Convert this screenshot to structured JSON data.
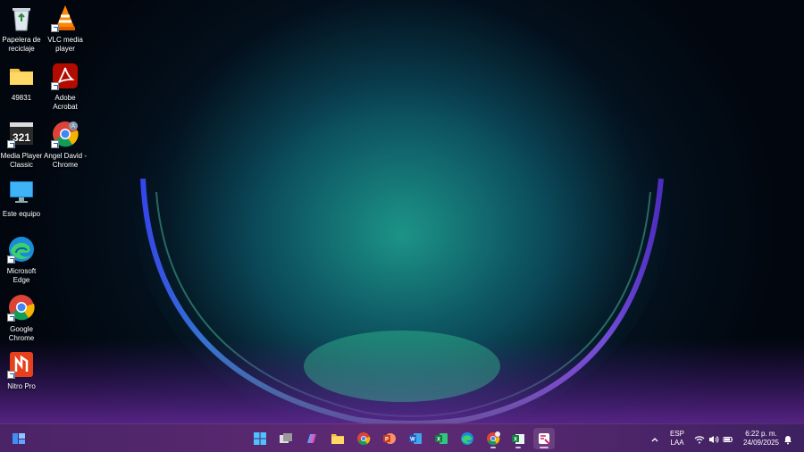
{
  "desktop": {
    "icons": [
      {
        "label": "Papelera de reciclaje",
        "icon": "recycle-bin-icon"
      },
      {
        "label": "VLC media player",
        "icon": "vlc-icon"
      },
      {
        "label": "49831",
        "icon": "folder-icon"
      },
      {
        "label": "Adobe Acrobat",
        "icon": "adobe-acrobat-icon"
      },
      {
        "label": "Media Player Classic",
        "icon": "media-player-classic-icon"
      },
      {
        "label": "Angel David - Chrome",
        "icon": "chrome-profile-icon"
      },
      {
        "label": "Este equipo",
        "icon": "monitor-icon"
      },
      {
        "label": "Microsoft Edge",
        "icon": "edge-icon"
      },
      {
        "label": "Google Chrome",
        "icon": "chrome-icon"
      },
      {
        "label": "Nitro Pro",
        "icon": "nitro-icon"
      }
    ]
  },
  "taskbar": {
    "apps": [
      "widgets-icon",
      "start-icon",
      "task-view-icon",
      "copilot-icon",
      "file-explorer-icon",
      "chrome-icon",
      "powerpoint-icon",
      "word-icon",
      "excel-icon",
      "edge-icon",
      "chrome-profile-icon",
      "excel-sheet-icon",
      "snipping-tool-icon"
    ],
    "language": {
      "line1": "ESP",
      "line2": "LAA"
    },
    "clock": {
      "time": "6:22 p. m.",
      "date": "24/09/2025"
    },
    "tray_icons": [
      "chevron-up-icon",
      "wifi-icon",
      "volume-icon",
      "battery-icon",
      "notification-bell-icon"
    ]
  },
  "colors": {
    "taskbar": "#5f2a74",
    "accent": "#1fb39a"
  }
}
